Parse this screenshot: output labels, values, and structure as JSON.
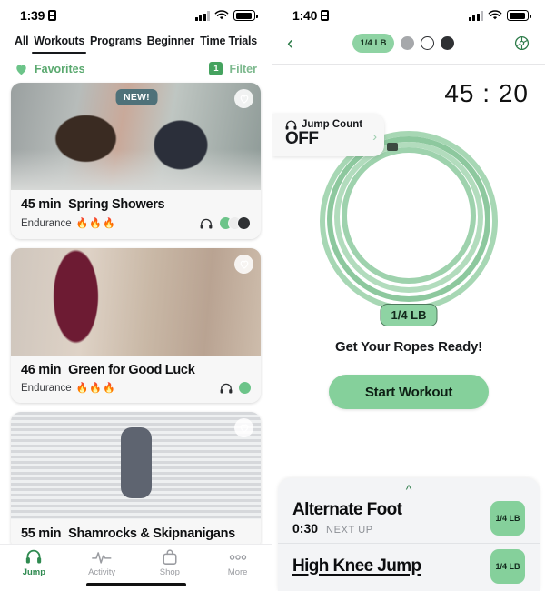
{
  "left": {
    "status": {
      "time": "1:39",
      "lock_icon": "lock-portrait-icon"
    },
    "tabs": [
      {
        "label": "All",
        "active": false
      },
      {
        "label": "Workouts",
        "active": true
      },
      {
        "label": "Programs",
        "active": false
      },
      {
        "label": "Beginner",
        "active": false
      },
      {
        "label": "Time Trials",
        "active": false
      }
    ],
    "subbar": {
      "favorites_label": "Favorites",
      "filter_label": "Filter",
      "filter_count": "1"
    },
    "cards": [
      {
        "badge": "NEW!",
        "duration": "45 min",
        "title": "Spring Showers",
        "category": "Endurance",
        "intensity": "🔥🔥🔥",
        "audio_icon": "headphones-icon",
        "weights": [
          "#6cc489",
          "#e9e9ea",
          "#2f3134"
        ]
      },
      {
        "badge": "",
        "duration": "46 min",
        "title": "Green for Good Luck",
        "category": "Endurance",
        "intensity": "🔥🔥🔥",
        "audio_icon": "headphones-icon",
        "weights": [
          "#6cc489"
        ]
      },
      {
        "badge": "",
        "duration": "55 min",
        "title": "Shamrocks & Skipnanigans",
        "category": "",
        "intensity": "",
        "audio_icon": "headphones-icon",
        "weights": []
      }
    ],
    "nav": [
      {
        "label": "Jump",
        "icon": "jump-rope-icon",
        "active": true
      },
      {
        "label": "Activity",
        "icon": "pulse-icon",
        "active": false
      },
      {
        "label": "Shop",
        "icon": "shopping-bag-icon",
        "active": false
      },
      {
        "label": "More",
        "icon": "ellipsis-icon",
        "active": false
      }
    ]
  },
  "right": {
    "status": {
      "time": "1:40",
      "lock_icon": "lock-portrait-icon"
    },
    "topnav": {
      "back_icon": "chevron-left-icon",
      "settings_icon": "gear-icon",
      "selected_weight": "1/4 LB",
      "weight_options": [
        "1/4 LB",
        "gray",
        "white",
        "dark"
      ]
    },
    "timer": "45 : 20",
    "tooltip": {
      "icon": "headphones-icon",
      "title": "Jump Count",
      "value": "OFF",
      "chevron": "chevron-right-icon"
    },
    "rope_badge": "1/4 LB",
    "ready_text": "Get Your Ropes Ready!",
    "start_label": "Start Workout",
    "sheet": {
      "handle_icon": "chevron-up-icon",
      "rows": [
        {
          "title": "Alternate Foot",
          "time": "0:30",
          "status": "NEXT UP",
          "badge": "1/4 LB",
          "underline": false
        },
        {
          "title": "High Knee Jump",
          "time": "",
          "status": "",
          "badge": "1/4 LB",
          "underline": true
        }
      ]
    }
  },
  "colors": {
    "accent": "#6cc489",
    "accent_dark": "#2f8a50",
    "badge_new": "#4f7179",
    "text": "#17191c"
  }
}
